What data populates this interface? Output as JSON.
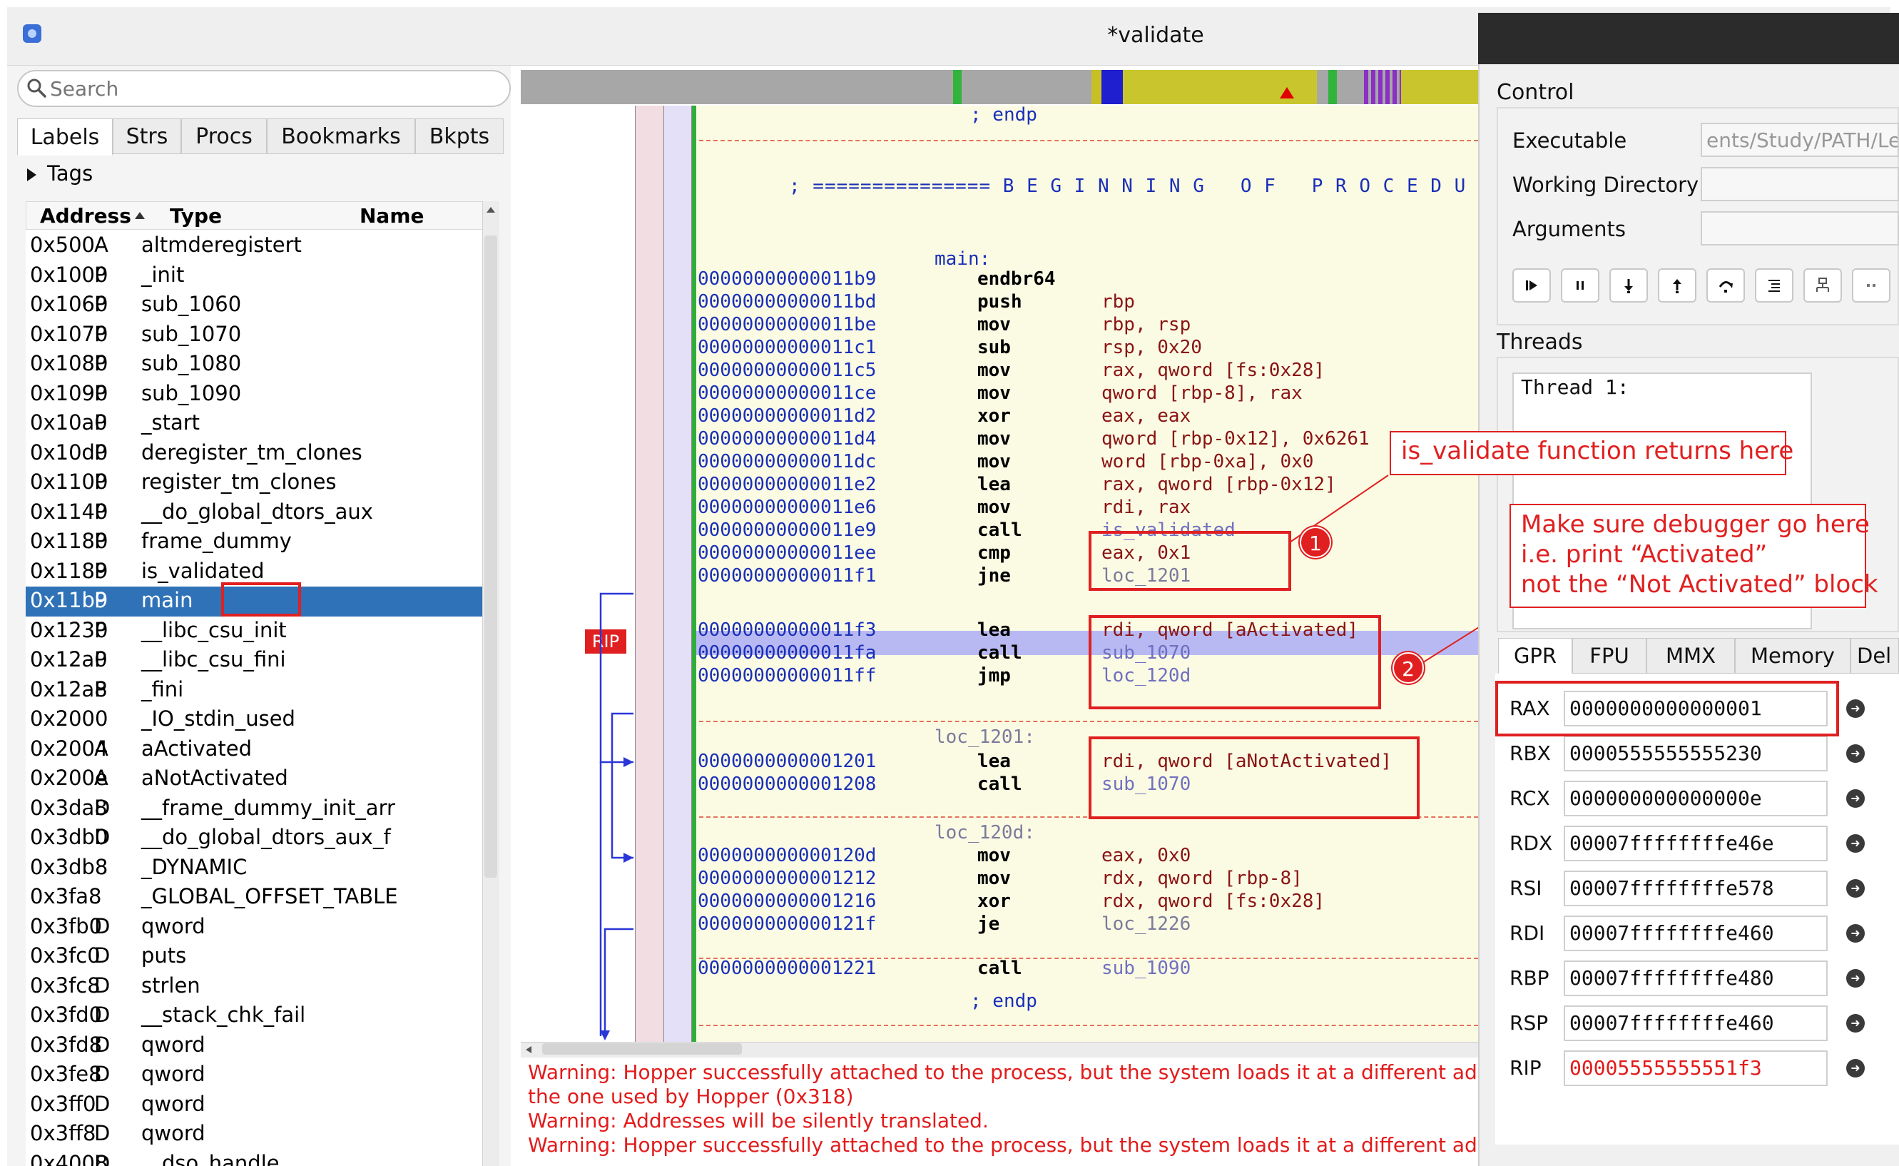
{
  "window": {
    "title": "*validate"
  },
  "search": {
    "placeholder": "Search"
  },
  "left_tabs": [
    "Labels",
    "Strs",
    "Procs",
    "Bookmarks",
    "Bkpts"
  ],
  "tags_label": "Tags",
  "labels_table": {
    "headers": {
      "address": "Address",
      "type": "Type",
      "name": "Name"
    },
    "rows": [
      {
        "address": "0x500",
        "type": "A",
        "name": "altmderegistert"
      },
      {
        "address": "0x1000",
        "type": "P",
        "name": "_init"
      },
      {
        "address": "0x1060",
        "type": "P",
        "name": "sub_1060"
      },
      {
        "address": "0x1070",
        "type": "P",
        "name": "sub_1070"
      },
      {
        "address": "0x1080",
        "type": "P",
        "name": "sub_1080"
      },
      {
        "address": "0x1090",
        "type": "P",
        "name": "sub_1090"
      },
      {
        "address": "0x10a0",
        "type": "P",
        "name": "_start"
      },
      {
        "address": "0x10d0",
        "type": "P",
        "name": "deregister_tm_clones"
      },
      {
        "address": "0x1100",
        "type": "P",
        "name": "register_tm_clones"
      },
      {
        "address": "0x1140",
        "type": "P",
        "name": "__do_global_dtors_aux"
      },
      {
        "address": "0x1180",
        "type": "P",
        "name": "frame_dummy"
      },
      {
        "address": "0x1189",
        "type": "P",
        "name": "is_validated"
      },
      {
        "address": "0x11b9",
        "type": "P",
        "name": "main"
      },
      {
        "address": "0x1230",
        "type": "P",
        "name": "__libc_csu_init"
      },
      {
        "address": "0x12a0",
        "type": "P",
        "name": "__libc_csu_fini"
      },
      {
        "address": "0x12a8",
        "type": "P",
        "name": "_fini"
      },
      {
        "address": "0x2000",
        "type": "",
        "name": "_IO_stdin_used"
      },
      {
        "address": "0x2004",
        "type": "A",
        "name": "aActivated"
      },
      {
        "address": "0x200e",
        "type": "A",
        "name": "aNotActivated"
      },
      {
        "address": "0x3da8",
        "type": "D",
        "name": "__frame_dummy_init_arr"
      },
      {
        "address": "0x3db0",
        "type": "D",
        "name": "__do_global_dtors_aux_f"
      },
      {
        "address": "0x3db8",
        "type": "",
        "name": "_DYNAMIC"
      },
      {
        "address": "0x3fa8",
        "type": "",
        "name": "_GLOBAL_OFFSET_TABLE"
      },
      {
        "address": "0x3fb0",
        "type": "D",
        "name": "qword"
      },
      {
        "address": "0x3fc0",
        "type": "D",
        "name": "puts"
      },
      {
        "address": "0x3fc8",
        "type": "D",
        "name": "strlen"
      },
      {
        "address": "0x3fd0",
        "type": "D",
        "name": "__stack_chk_fail"
      },
      {
        "address": "0x3fd8",
        "type": "D",
        "name": "qword"
      },
      {
        "address": "0x3fe8",
        "type": "D",
        "name": "qword"
      },
      {
        "address": "0x3ff0",
        "type": "D",
        "name": "qword"
      },
      {
        "address": "0x3ff8",
        "type": "D",
        "name": "qword"
      },
      {
        "address": "0x4008",
        "type": "D",
        "name": "__dso_handle"
      }
    ],
    "selected_index": 12
  },
  "disasm": {
    "endp1": "; endp",
    "proc_banner": "; =============== B E G I N N I N G   O F   P R O C E D U R",
    "main_label": "main:",
    "lines": [
      {
        "addr": "00000000000011b9",
        "mn": "endbr64",
        "ops": ""
      },
      {
        "addr": "00000000000011bd",
        "mn": "push",
        "ops": "rbp"
      },
      {
        "addr": "00000000000011be",
        "mn": "mov",
        "ops": "rbp, rsp"
      },
      {
        "addr": "00000000000011c1",
        "mn": "sub",
        "ops": "rsp, 0x20"
      },
      {
        "addr": "00000000000011c5",
        "mn": "mov",
        "ops": "rax, qword [fs:0x28]"
      },
      {
        "addr": "00000000000011ce",
        "mn": "mov",
        "ops": "qword [rbp-8], rax"
      },
      {
        "addr": "00000000000011d2",
        "mn": "xor",
        "ops": "eax, eax"
      },
      {
        "addr": "00000000000011d4",
        "mn": "mov",
        "ops": "qword [rbp-0x12], 0x6261"
      },
      {
        "addr": "00000000000011dc",
        "mn": "mov",
        "ops": "word [rbp-0xa], 0x0"
      },
      {
        "addr": "00000000000011e2",
        "mn": "lea",
        "ops": "rax, qword [rbp-0x12]"
      },
      {
        "addr": "00000000000011e6",
        "mn": "mov",
        "ops": "rdi, rax"
      },
      {
        "addr": "00000000000011e9",
        "mn": "call",
        "ops": "is_validated"
      },
      {
        "addr": "00000000000011ee",
        "mn": "cmp",
        "ops": "eax, 0x1"
      },
      {
        "addr": "00000000000011f1",
        "mn": "jne",
        "ops": "loc_1201"
      },
      {
        "addr": "00000000000011f3",
        "mn": "lea",
        "ops": "rdi, qword [aActivated]"
      },
      {
        "addr": "00000000000011fa",
        "mn": "call",
        "ops": "sub_1070"
      },
      {
        "addr": "00000000000011ff",
        "mn": "jmp",
        "ops": "loc_120d"
      },
      {
        "addr": "0000000000001201",
        "mn": "lea",
        "ops": "rdi, qword [aNotActivated]"
      },
      {
        "addr": "0000000000001208",
        "mn": "call",
        "ops": "sub_1070"
      },
      {
        "addr": "000000000000120d",
        "mn": "mov",
        "ops": "eax, 0x0"
      },
      {
        "addr": "0000000000001212",
        "mn": "mov",
        "ops": "rdx, qword [rbp-8]"
      },
      {
        "addr": "0000000000001216",
        "mn": "xor",
        "ops": "rdx, qword [fs:0x28]"
      },
      {
        "addr": "000000000000121f",
        "mn": "je",
        "ops": "loc_1226"
      },
      {
        "addr": "0000000000001221",
        "mn": "call",
        "ops": "sub_1090"
      }
    ],
    "loc_1201_label": "loc_1201:",
    "loc_120d_label": "loc_120d:",
    "endp2": "; endp",
    "rip_tag": "RIP"
  },
  "log": [
    "Warning: Hopper successfully attached to the process, but the system loads it at a different address",
    "the one used by Hopper (0x318)",
    "Warning: Addresses will be silently translated.",
    "Warning: Hopper successfully attached to the process, but the system loads it at a different address"
  ],
  "annotations": {
    "badge1": "1",
    "badge2": "2",
    "callout1": "is_validate function returns here",
    "callout2_lines": [
      "Make sure debugger go here",
      "i.e. print “Activated”",
      "not the “Not Activated” block"
    ]
  },
  "control": {
    "title": "Control",
    "executable_label": "Executable",
    "executable_value": "ents/Study/PATH/Le",
    "workdir_label": "Working Directory",
    "workdir_value": "",
    "args_label": "Arguments",
    "args_value": "",
    "buttons": [
      "continue",
      "pause",
      "step-into",
      "step-out",
      "step-over",
      "list",
      "process",
      "more"
    ]
  },
  "threads": {
    "title": "Threads",
    "items": [
      "Thread 1:"
    ]
  },
  "reg_tabs": [
    "GPR",
    "FPU",
    "MMX",
    "Memory",
    "Del"
  ],
  "registers": [
    {
      "name": "RAX",
      "value": "0000000000000001",
      "changed": false
    },
    {
      "name": "RBX",
      "value": "0000555555555230",
      "changed": false
    },
    {
      "name": "RCX",
      "value": "000000000000000e",
      "changed": false
    },
    {
      "name": "RDX",
      "value": "00007ffffffffe46e",
      "changed": false
    },
    {
      "name": "RSI",
      "value": "00007ffffffffe578",
      "changed": false
    },
    {
      "name": "RDI",
      "value": "00007ffffffffe460",
      "changed": false
    },
    {
      "name": "RBP",
      "value": "00007ffffffffe480",
      "changed": false
    },
    {
      "name": "RSP",
      "value": "00007ffffffffe460",
      "changed": false
    },
    {
      "name": "RIP",
      "value": "00005555555551f3",
      "changed": true
    }
  ],
  "colors": {
    "selection": "#2f72b7",
    "annotation_red": "#e02020",
    "rip_highlight": "#b8b9f3"
  }
}
